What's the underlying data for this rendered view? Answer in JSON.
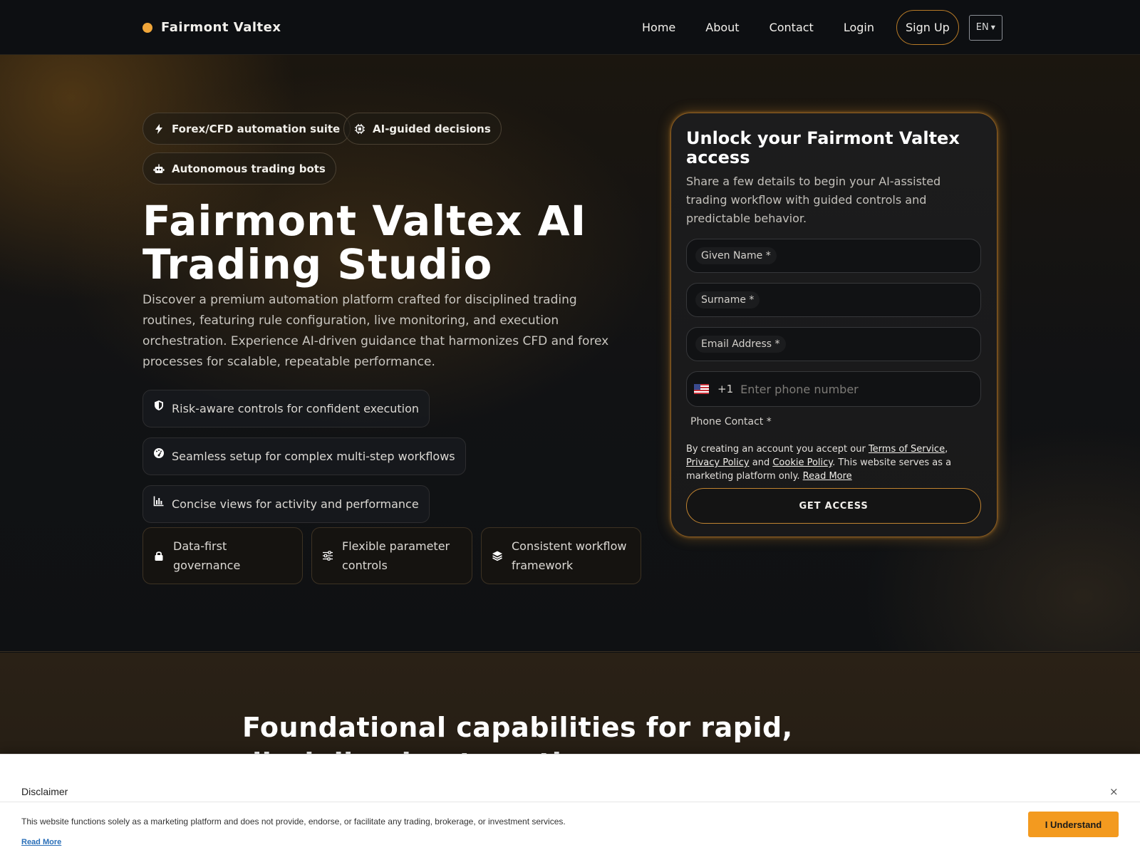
{
  "nav": {
    "brand": "Fairmont Valtex",
    "links": [
      "Home",
      "About",
      "Contact",
      "Login"
    ],
    "signup": "Sign Up",
    "language": "EN"
  },
  "hero": {
    "chips": [
      "Forex/CFD automation suite",
      "AI-guided decisions",
      "Autonomous trading bots"
    ],
    "title": "Fairmont Valtex AI Trading Studio",
    "description": "Discover a premium automation platform crafted for disciplined trading routines, featuring rule configuration, live monitoring, and execution orchestration. Experience AI-driven guidance that harmonizes CFD and forex processes for scalable, repeatable performance.",
    "features": [
      "Risk-aware controls for confident execution",
      "Seamless setup for complex multi-step workflows",
      "Concise views for activity and performance"
    ],
    "cards": [
      "Data-first governance",
      "Flexible parameter controls",
      "Consistent workflow framework"
    ]
  },
  "form": {
    "title": "Unlock your Fairmont Valtex access",
    "subtitle": "Share a few details to begin your AI-assisted trading workflow with guided controls and predictable behavior.",
    "given_name_label": "Given Name *",
    "surname_label": "Surname *",
    "email_label": "Email Address *",
    "phone_dial": "+1",
    "phone_placeholder": "Enter phone number",
    "phone_label": "Phone Contact *",
    "legal": {
      "prefix": "By creating an account you accept our ",
      "terms": "Terms of Service",
      "comma": ",",
      "privacy": "Privacy Policy",
      "and": " and ",
      "cookie": "Cookie Policy",
      "suffix": ". This website serves as a marketing platform only. ",
      "read_more": "Read More"
    },
    "submit": "GET ACCESS"
  },
  "section2": {
    "title": "Foundational capabilities for rapid, disciplined automation"
  },
  "disclaimer": {
    "title": "Disclaimer",
    "close": "×",
    "text": "This website functions solely as a marketing platform and does not provide, endorse, or facilitate any trading, brokerage, or investment services.",
    "read_more": "Read More",
    "button": "I Understand"
  },
  "colors": {
    "accent": "#f0a63a",
    "button_orange": "#f39a1f",
    "link_blue": "#2a6fb8"
  }
}
